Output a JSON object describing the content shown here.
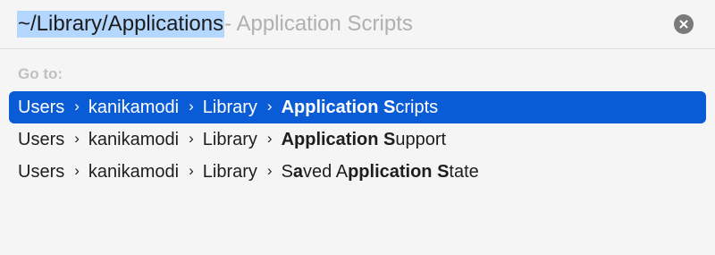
{
  "search": {
    "typed_text": "~/Library/Applications",
    "completion_text": " - Application Scripts"
  },
  "goto_label": "Go to:",
  "separator": "›",
  "results": [
    {
      "selected": true,
      "segments": [
        "Users",
        "kanikamodi",
        "Library"
      ],
      "last": [
        {
          "text": "Application S",
          "bold": true
        },
        {
          "text": "cripts",
          "bold": false
        }
      ]
    },
    {
      "selected": false,
      "segments": [
        "Users",
        "kanikamodi",
        "Library"
      ],
      "last": [
        {
          "text": "Application S",
          "bold": true
        },
        {
          "text": "upport",
          "bold": false
        }
      ]
    },
    {
      "selected": false,
      "segments": [
        "Users",
        "kanikamodi",
        "Library"
      ],
      "last": [
        {
          "text": "S",
          "bold": false
        },
        {
          "text": "a",
          "bold": true
        },
        {
          "text": "ved A",
          "bold": false
        },
        {
          "text": "pplication S",
          "bold": true
        },
        {
          "text": "tate",
          "bold": false
        }
      ]
    }
  ],
  "colors": {
    "selection_highlight": "#0a5cd6",
    "typed_highlight": "#b3d7ff",
    "clear_button": "#7a7a7a"
  },
  "icons": {
    "clear": "close-circle-icon"
  }
}
